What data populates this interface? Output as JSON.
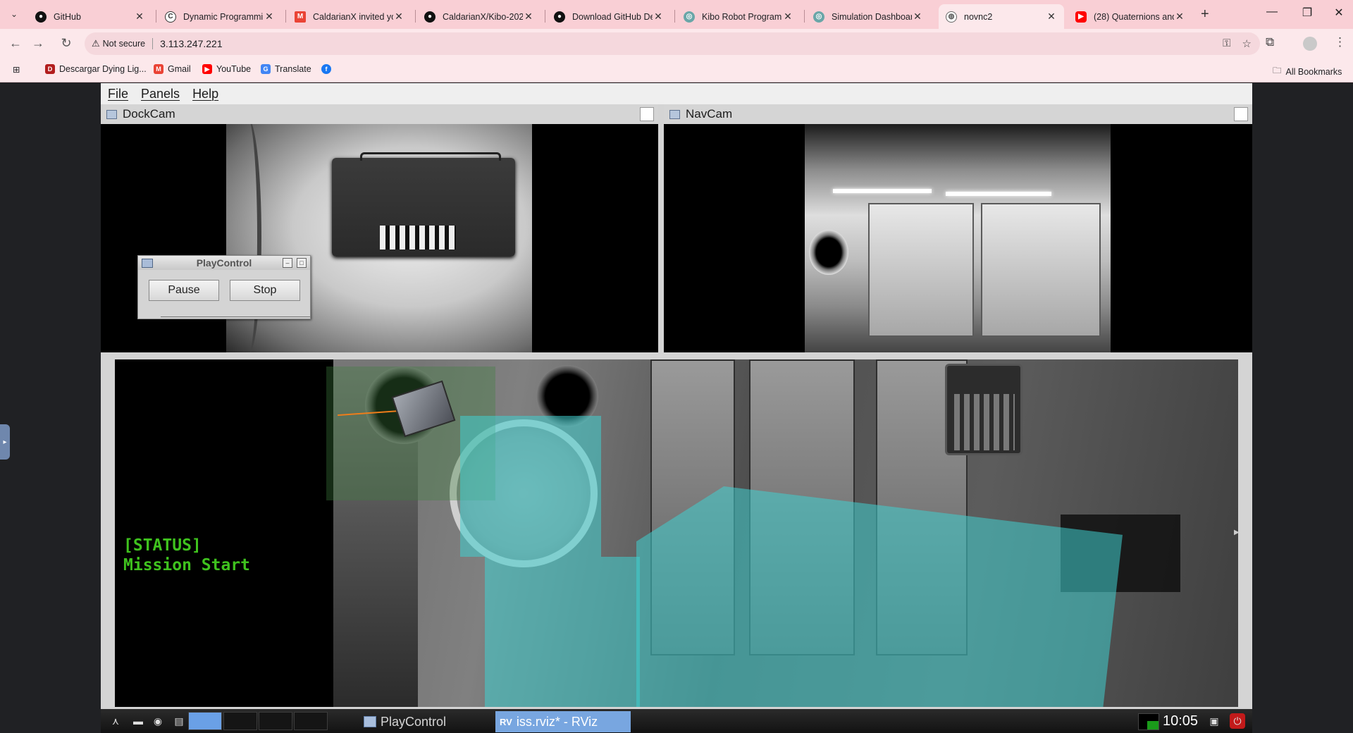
{
  "browser": {
    "tabs": [
      {
        "title": "GitHub",
        "icon": "github-icon",
        "active": false
      },
      {
        "title": "Dynamic Programming",
        "icon": "app-icon",
        "active": false
      },
      {
        "title": "CaldarianX invited yo",
        "icon": "gmail-icon",
        "active": false
      },
      {
        "title": "CaldarianX/Kibo-202",
        "icon": "github-icon",
        "active": false
      },
      {
        "title": "Download GitHub De",
        "icon": "github-icon",
        "active": false
      },
      {
        "title": "Kibo Robot Program",
        "icon": "kibo-icon",
        "active": false
      },
      {
        "title": "Simulation Dashboar",
        "icon": "kibo-icon",
        "active": false
      },
      {
        "title": "novnc2",
        "icon": "globe-icon",
        "active": true
      },
      {
        "title": "(28) Quaternions and",
        "icon": "youtube-icon",
        "active": false
      }
    ],
    "new_tab_label": "+",
    "address": {
      "security_label": "Not secure",
      "url": "3.113.247.221"
    },
    "bookmarks": [
      {
        "label": "Descargar Dying Lig...",
        "icon": "game-icon"
      },
      {
        "label": "Gmail",
        "icon": "gmail-icon"
      },
      {
        "label": "YouTube",
        "icon": "youtube-icon"
      },
      {
        "label": "Translate",
        "icon": "translate-icon"
      },
      {
        "label": "",
        "icon": "facebook-icon"
      }
    ],
    "all_bookmarks_label": "All Bookmarks",
    "colors": {
      "tabbar": "#f9cfd5",
      "toolbar": "#fce8eb"
    }
  },
  "rviz_app": {
    "menu": [
      "File",
      "Panels",
      "Help"
    ],
    "panels": {
      "dockcam": {
        "title": "DockCam"
      },
      "navcam": {
        "title": "NavCam"
      }
    },
    "status_overlay": "[STATUS]\nMission Start",
    "status_color": "#3fc21e"
  },
  "playcontrol": {
    "title": "PlayControl",
    "pause_label": "Pause",
    "stop_label": "Stop"
  },
  "taskbar": {
    "tasks": [
      {
        "label": "PlayControl",
        "active": false
      },
      {
        "label": "iss.rviz* - RViz",
        "active": true
      }
    ],
    "clock": "10:05"
  }
}
